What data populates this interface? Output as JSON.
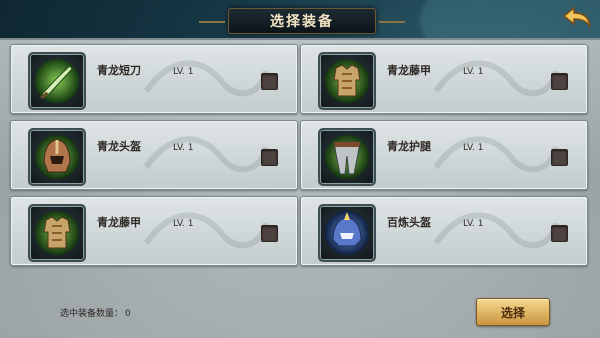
{
  "header": {
    "title": "选择装备",
    "back_icon": "back-arrow-icon"
  },
  "items": [
    {
      "name": "青龙短刀",
      "level": "LV. 1",
      "icon": "dagger-icon",
      "checked": false
    },
    {
      "name": "青龙藤甲",
      "level": "LV. 1",
      "icon": "armor-icon",
      "checked": false
    },
    {
      "name": "青龙头盔",
      "level": "LV. 1",
      "icon": "helmet-icon",
      "checked": false
    },
    {
      "name": "青龙护腿",
      "level": "LV. 1",
      "icon": "leg-guard-icon",
      "checked": false
    },
    {
      "name": "青龙藤甲",
      "level": "LV. 1",
      "icon": "armor-icon",
      "checked": false
    },
    {
      "name": "百炼头盔",
      "level": "LV. 1",
      "icon": "helmet-blue-icon",
      "checked": false
    }
  ],
  "footer": {
    "selected_label": "选中装备数量：",
    "selected_count": "0",
    "select_button": "选择"
  },
  "colors": {
    "accent_gold": "#c9953f",
    "card_bg": "#d5dcdd",
    "item_glow_green": "#4fae2e"
  }
}
